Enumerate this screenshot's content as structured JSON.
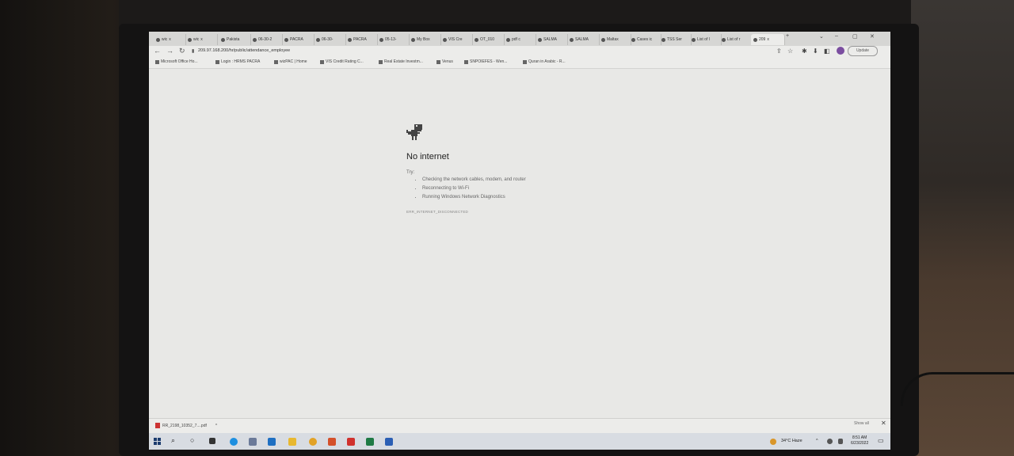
{
  "tabs": [
    {
      "label": "wic",
      "close": "x"
    },
    {
      "label": "wic",
      "close": "x"
    },
    {
      "label": "Pakista"
    },
    {
      "label": "06-30-2"
    },
    {
      "label": "PACRA"
    },
    {
      "label": "06-30-"
    },
    {
      "label": "PACRA"
    },
    {
      "label": "05-13-"
    },
    {
      "label": "My Box"
    },
    {
      "label": "VIS Cre"
    },
    {
      "label": "OT_010"
    },
    {
      "label": "pdf c"
    },
    {
      "label": "SALMA"
    },
    {
      "label": "SALMA"
    },
    {
      "label": "Maltax"
    },
    {
      "label": "Cases ic"
    },
    {
      "label": "TSS Ser"
    },
    {
      "label": "List of l"
    },
    {
      "label": "List of r"
    },
    {
      "label": "209",
      "close": "x"
    }
  ],
  "new_tab": "+",
  "window_controls": {
    "minimize": "–",
    "maximize": "▢",
    "close": "✕",
    "tab_search": "⌄"
  },
  "nav": {
    "back": "←",
    "forward": "→",
    "reload": "↻",
    "lock": "▮"
  },
  "url": "209.97.168.200/hr/public/attendance_employee",
  "toolbar_icons": {
    "share": "⇪",
    "star": "☆",
    "extension": "✱",
    "download": "⬇",
    "sidebar": "◧"
  },
  "profile_initials": "",
  "update_label": "Update",
  "bookmarks": [
    "Microsoft Office Ho...",
    "Login : HRMS PACRA",
    "wizPAC | Home",
    "VIS Credit Rating C...",
    "Real Estate Investm...",
    "Venus",
    "SNPOIEFES - Wen...",
    "Quran in Arabic - R..."
  ],
  "error": {
    "title": "No internet",
    "try": "Try:",
    "suggestions": [
      "Checking the network cables, modem, and router",
      "Reconnecting to Wi-Fi",
      "Running Windows Network Diagnostics"
    ],
    "code": "ERR_INTERNET_DISCONNECTED"
  },
  "download": {
    "filename": "RR_2198_10352_7....pdf",
    "chevron": "^",
    "show_all": "Show all",
    "close": "✕"
  },
  "taskbar": {
    "search_glyph": "⌕",
    "taskview_glyph": "○",
    "weather": "34°C Haze",
    "clock_time": "8:51 AM",
    "clock_date": "6/23/2022",
    "tray_up": "^",
    "notification_glyph": "▭"
  },
  "colors": {
    "screen_bg": "#e9e9e7",
    "taskbar": "#d8dce2",
    "profile": "#7b4ea0"
  }
}
